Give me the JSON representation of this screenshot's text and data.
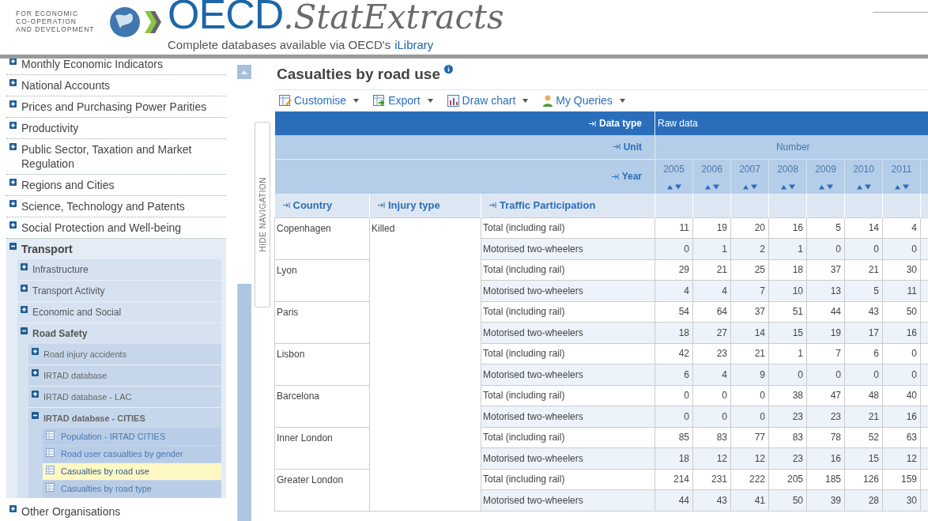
{
  "header": {
    "org_lines": [
      "FOR ECONOMIC",
      "CO-OPERATION",
      "AND DEVELOPMENT"
    ],
    "brand": "OECD",
    "brand_suffix": ".StatExtracts",
    "tagline": "Complete databases available via OECD's",
    "tagline_link": "iLibrary"
  },
  "sidebar": {
    "items": [
      {
        "label": "Monthly Economic Indicators",
        "kind": "folder",
        "expanded": false
      },
      {
        "label": "National Accounts",
        "kind": "folder",
        "expanded": false
      },
      {
        "label": "Prices and Purchasing Power Parities",
        "kind": "folder",
        "expanded": false
      },
      {
        "label": "Productivity",
        "kind": "folder",
        "expanded": false
      },
      {
        "label": "Public Sector, Taxation and Market Regulation",
        "kind": "folder",
        "expanded": false
      },
      {
        "label": "Regions and Cities",
        "kind": "folder",
        "expanded": false
      },
      {
        "label": "Science, Technology and Patents",
        "kind": "folder",
        "expanded": false
      },
      {
        "label": "Social Protection and Well-being",
        "kind": "folder",
        "expanded": false
      },
      {
        "label": "Transport",
        "kind": "folder",
        "expanded": true,
        "children": [
          {
            "label": "Infrastructure",
            "kind": "folder",
            "expanded": false
          },
          {
            "label": "Transport Activity",
            "kind": "folder",
            "expanded": false
          },
          {
            "label": "Economic and Social",
            "kind": "folder",
            "expanded": false
          },
          {
            "label": "Road Safety",
            "kind": "folder",
            "expanded": true,
            "children": [
              {
                "label": "Road injury accidents",
                "kind": "folder",
                "expanded": false
              },
              {
                "label": "IRTAD database",
                "kind": "folder",
                "expanded": false
              },
              {
                "label": "IRTAD database - LAC",
                "kind": "folder",
                "expanded": false
              },
              {
                "label": "IRTAD database - CITIES",
                "kind": "folder",
                "expanded": true,
                "children": [
                  {
                    "label": "Population - IRTAD CITIES",
                    "kind": "dataset",
                    "selected": false
                  },
                  {
                    "label": "Road user casualties by gender",
                    "kind": "dataset",
                    "selected": false
                  },
                  {
                    "label": "Casualties by road use",
                    "kind": "dataset",
                    "selected": true
                  },
                  {
                    "label": "Casualties by road type",
                    "kind": "dataset",
                    "selected": false
                  }
                ]
              }
            ]
          }
        ]
      },
      {
        "label": "Other Organisations",
        "kind": "folder",
        "expanded": false
      }
    ]
  },
  "hide_navigation": "HIDE NAVIGATION",
  "main": {
    "title": "Casualties by road use",
    "toolbar": [
      {
        "label": "Customise"
      },
      {
        "label": "Export"
      },
      {
        "label": "Draw chart"
      },
      {
        "label": "My Queries"
      }
    ],
    "table": {
      "header_rows": [
        {
          "label": "Data type",
          "value": "Raw data"
        },
        {
          "label": "Unit",
          "value": "Number"
        }
      ],
      "year_label": "Year",
      "years": [
        "2005",
        "2006",
        "2007",
        "2008",
        "2009",
        "2010",
        "2011"
      ],
      "columns": [
        "Country",
        "Injury type",
        "Traffic Participation"
      ],
      "groups": [
        {
          "country": "Copenhagen",
          "injury": "Killed",
          "rows": [
            {
              "participation": "Total (including rail)",
              "values": [
                "11",
                "19",
                "20",
                "16",
                "5",
                "14",
                "4"
              ]
            },
            {
              "participation": "Motorised two-wheelers",
              "values": [
                "0",
                "1",
                "2",
                "1",
                "0",
                "0",
                "0"
              ]
            }
          ]
        },
        {
          "country": "Lyon",
          "rows": [
            {
              "participation": "Total (including rail)",
              "values": [
                "29",
                "21",
                "25",
                "18",
                "37",
                "21",
                "30"
              ]
            },
            {
              "participation": "Motorised two-wheelers",
              "values": [
                "4",
                "4",
                "7",
                "10",
                "13",
                "5",
                "11"
              ]
            }
          ]
        },
        {
          "country": "Paris",
          "rows": [
            {
              "participation": "Total (including rail)",
              "values": [
                "54",
                "64",
                "37",
                "51",
                "44",
                "43",
                "50"
              ]
            },
            {
              "participation": "Motorised two-wheelers",
              "values": [
                "18",
                "27",
                "14",
                "15",
                "19",
                "17",
                "16"
              ]
            }
          ]
        },
        {
          "country": "Lisbon",
          "rows": [
            {
              "participation": "Total (including rail)",
              "values": [
                "42",
                "23",
                "21",
                "1",
                "7",
                "6",
                "0"
              ]
            },
            {
              "participation": "Motorised two-wheelers",
              "values": [
                "6",
                "4",
                "9",
                "0",
                "0",
                "0",
                "0"
              ]
            }
          ]
        },
        {
          "country": "Barcelona",
          "rows": [
            {
              "participation": "Total (including rail)",
              "values": [
                "0",
                "0",
                "0",
                "38",
                "47",
                "48",
                "40"
              ]
            },
            {
              "participation": "Motorised two-wheelers",
              "values": [
                "0",
                "0",
                "0",
                "23",
                "23",
                "21",
                "16"
              ]
            }
          ]
        },
        {
          "country": "Inner London",
          "rows": [
            {
              "participation": "Total (including rail)",
              "values": [
                "85",
                "83",
                "77",
                "83",
                "78",
                "52",
                "63"
              ]
            },
            {
              "participation": "Motorised two-wheelers",
              "values": [
                "18",
                "12",
                "12",
                "23",
                "16",
                "15",
                "12"
              ]
            }
          ]
        },
        {
          "country": "Greater London",
          "rows": [
            {
              "participation": "Total (including rail)",
              "values": [
                "214",
                "231",
                "222",
                "205",
                "185",
                "126",
                "159"
              ]
            },
            {
              "participation": "Motorised two-wheelers",
              "values": [
                "44",
                "43",
                "41",
                "50",
                "39",
                "28",
                "30"
              ]
            }
          ]
        }
      ]
    }
  }
}
